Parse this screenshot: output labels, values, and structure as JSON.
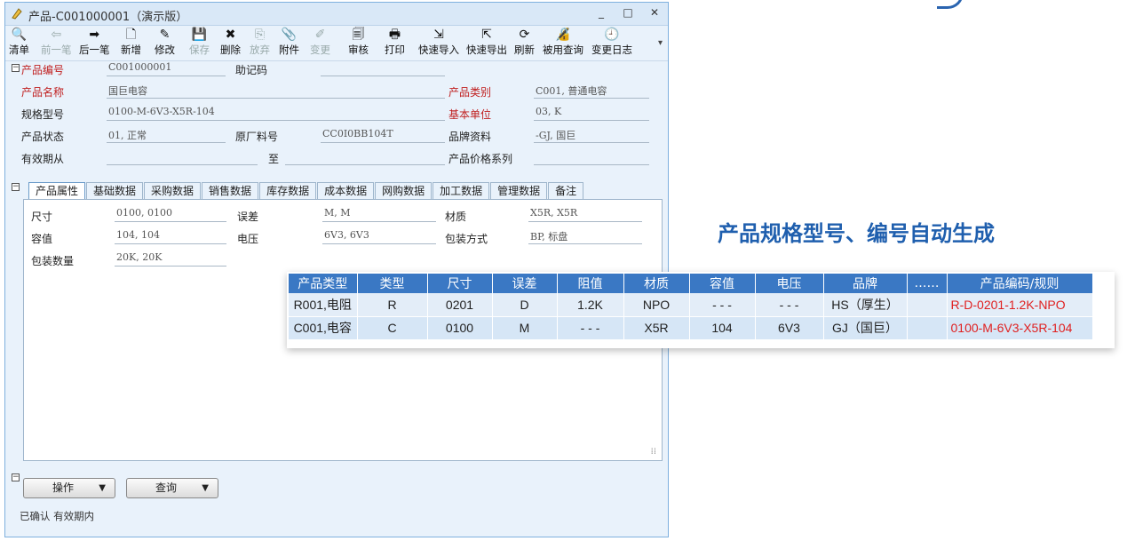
{
  "window": {
    "title": "产品-C001000001（演示版）",
    "controls": [
      "_",
      "□",
      "✕"
    ]
  },
  "toolbar": [
    {
      "label": "清单",
      "icon": "list-search-icon",
      "glyph": "🔍",
      "enabled": true
    },
    {
      "label": "前一笔",
      "icon": "arrow-left-icon",
      "glyph": "⇦",
      "enabled": false
    },
    {
      "label": "后一笔",
      "icon": "arrow-right-icon",
      "glyph": "➡",
      "enabled": true
    },
    {
      "label": "新增",
      "icon": "new-document-icon",
      "glyph": "🗋",
      "enabled": true
    },
    {
      "label": "修改",
      "icon": "edit-icon",
      "glyph": "✎",
      "enabled": true
    },
    {
      "label": "保存",
      "icon": "save-icon",
      "glyph": "💾",
      "enabled": false
    },
    {
      "label": "删除",
      "icon": "delete-icon",
      "glyph": "✖",
      "enabled": true
    },
    {
      "label": "放弃",
      "icon": "discard-icon",
      "glyph": "⎘",
      "enabled": false
    },
    {
      "label": "附件",
      "icon": "attachment-icon",
      "glyph": "📎",
      "enabled": true
    },
    {
      "label": "变更",
      "icon": "change-icon",
      "glyph": "✐",
      "enabled": false
    },
    {
      "label": "审核",
      "icon": "audit-icon",
      "glyph": "🗐",
      "enabled": true
    },
    {
      "label": "打印",
      "icon": "print-icon",
      "glyph": "🖶",
      "enabled": true
    },
    {
      "label": "快速导入",
      "icon": "quick-import-icon",
      "glyph": "⇲",
      "enabled": true
    },
    {
      "label": "快速导出",
      "icon": "quick-export-icon",
      "glyph": "⇱",
      "enabled": true
    },
    {
      "label": "刷新",
      "icon": "refresh-icon",
      "glyph": "⟳",
      "enabled": true
    },
    {
      "label": "被用查询",
      "icon": "usage-query-icon",
      "glyph": "🔏",
      "enabled": true
    },
    {
      "label": "变更日志",
      "icon": "change-log-icon",
      "glyph": "🕘",
      "enabled": true
    }
  ],
  "form": {
    "product_code": {
      "label": "产品编号",
      "value": "C001000001"
    },
    "mnemonic": {
      "label": "助记码",
      "value": ""
    },
    "product_name": {
      "label": "产品名称",
      "value": "国巨电容"
    },
    "product_category": {
      "label": "产品类别",
      "value": "C001, 普通电容"
    },
    "spec_model": {
      "label": "规格型号",
      "value": "0100-M-6V3-X5R-104"
    },
    "base_unit": {
      "label": "基本单位",
      "value": "03, K"
    },
    "product_status": {
      "label": "产品状态",
      "value": "01, 正常"
    },
    "factory_part_no": {
      "label": "原厂料号",
      "value": "CC0I0BB104T"
    },
    "brand": {
      "label": "品牌资料",
      "value": "-GJ, 国巨"
    },
    "valid_from": {
      "label": "有效期从",
      "value": ""
    },
    "valid_to": {
      "label": "至",
      "value": ""
    },
    "price_series": {
      "label": "产品价格系列",
      "value": ""
    }
  },
  "tabs": [
    "产品属性",
    "基础数据",
    "采购数据",
    "销售数据",
    "库存数据",
    "成本数据",
    "网购数据",
    "加工数据",
    "管理数据",
    "备注"
  ],
  "attributes": {
    "size": {
      "label": "尺寸",
      "value": "0100, 0100"
    },
    "tolerance": {
      "label": "误差",
      "value": "M, M"
    },
    "material": {
      "label": "材质",
      "value": "X5R, X5R"
    },
    "capacitance": {
      "label": "容值",
      "value": "104, 104"
    },
    "voltage": {
      "label": "电压",
      "value": "6V3, 6V3"
    },
    "package": {
      "label": "包装方式",
      "value": "BP, 标盘"
    },
    "package_qty": {
      "label": "包装数量",
      "value": "20K, 20K"
    }
  },
  "bottom": {
    "operate_label": "操作",
    "query_label": "查询",
    "status": "已确认 有效期内"
  },
  "headline": "产品规格型号、编号自动生成",
  "spec_table": {
    "headers": [
      "产品类型",
      "类型",
      "尺寸",
      "误差",
      "阻值",
      "材质",
      "容值",
      "电压",
      "品牌",
      "……",
      "产品编码/规则"
    ],
    "rows": [
      [
        "R001,电阻",
        "R",
        "0201",
        "D",
        "1.2K",
        "NPO",
        "- - -",
        "- - -",
        "HS（厚生）",
        "",
        "R-D-0201-1.2K-NPO"
      ],
      [
        "C001,电容",
        "C",
        "0100",
        "M",
        "- - -",
        "X5R",
        "104",
        "6V3",
        "GJ（国巨）",
        "",
        "0100-M-6V3-X5R-104"
      ]
    ]
  },
  "colors": {
    "accent": "#3a78c4",
    "required_label": "#c02020",
    "code_text": "#e02020",
    "headline": "#1f5fae"
  }
}
